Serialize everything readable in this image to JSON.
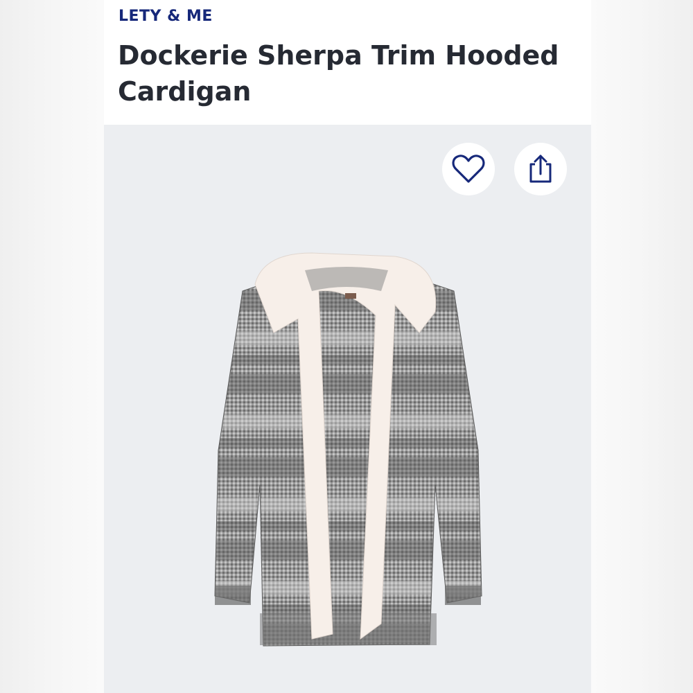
{
  "product": {
    "brand": "LETY & ME",
    "title": "Dockerie Sherpa Trim Hooded Cardigan"
  },
  "actions": {
    "favorite_icon": "heart-outline-icon",
    "share_icon": "share-upload-icon",
    "icon_color": "#16287a"
  },
  "image": {
    "subject": "hooded-cardigan",
    "knit_colors": [
      "#8e8e8e",
      "#b9b9b9",
      "#646464"
    ],
    "lining_color": "#f7efe9"
  }
}
